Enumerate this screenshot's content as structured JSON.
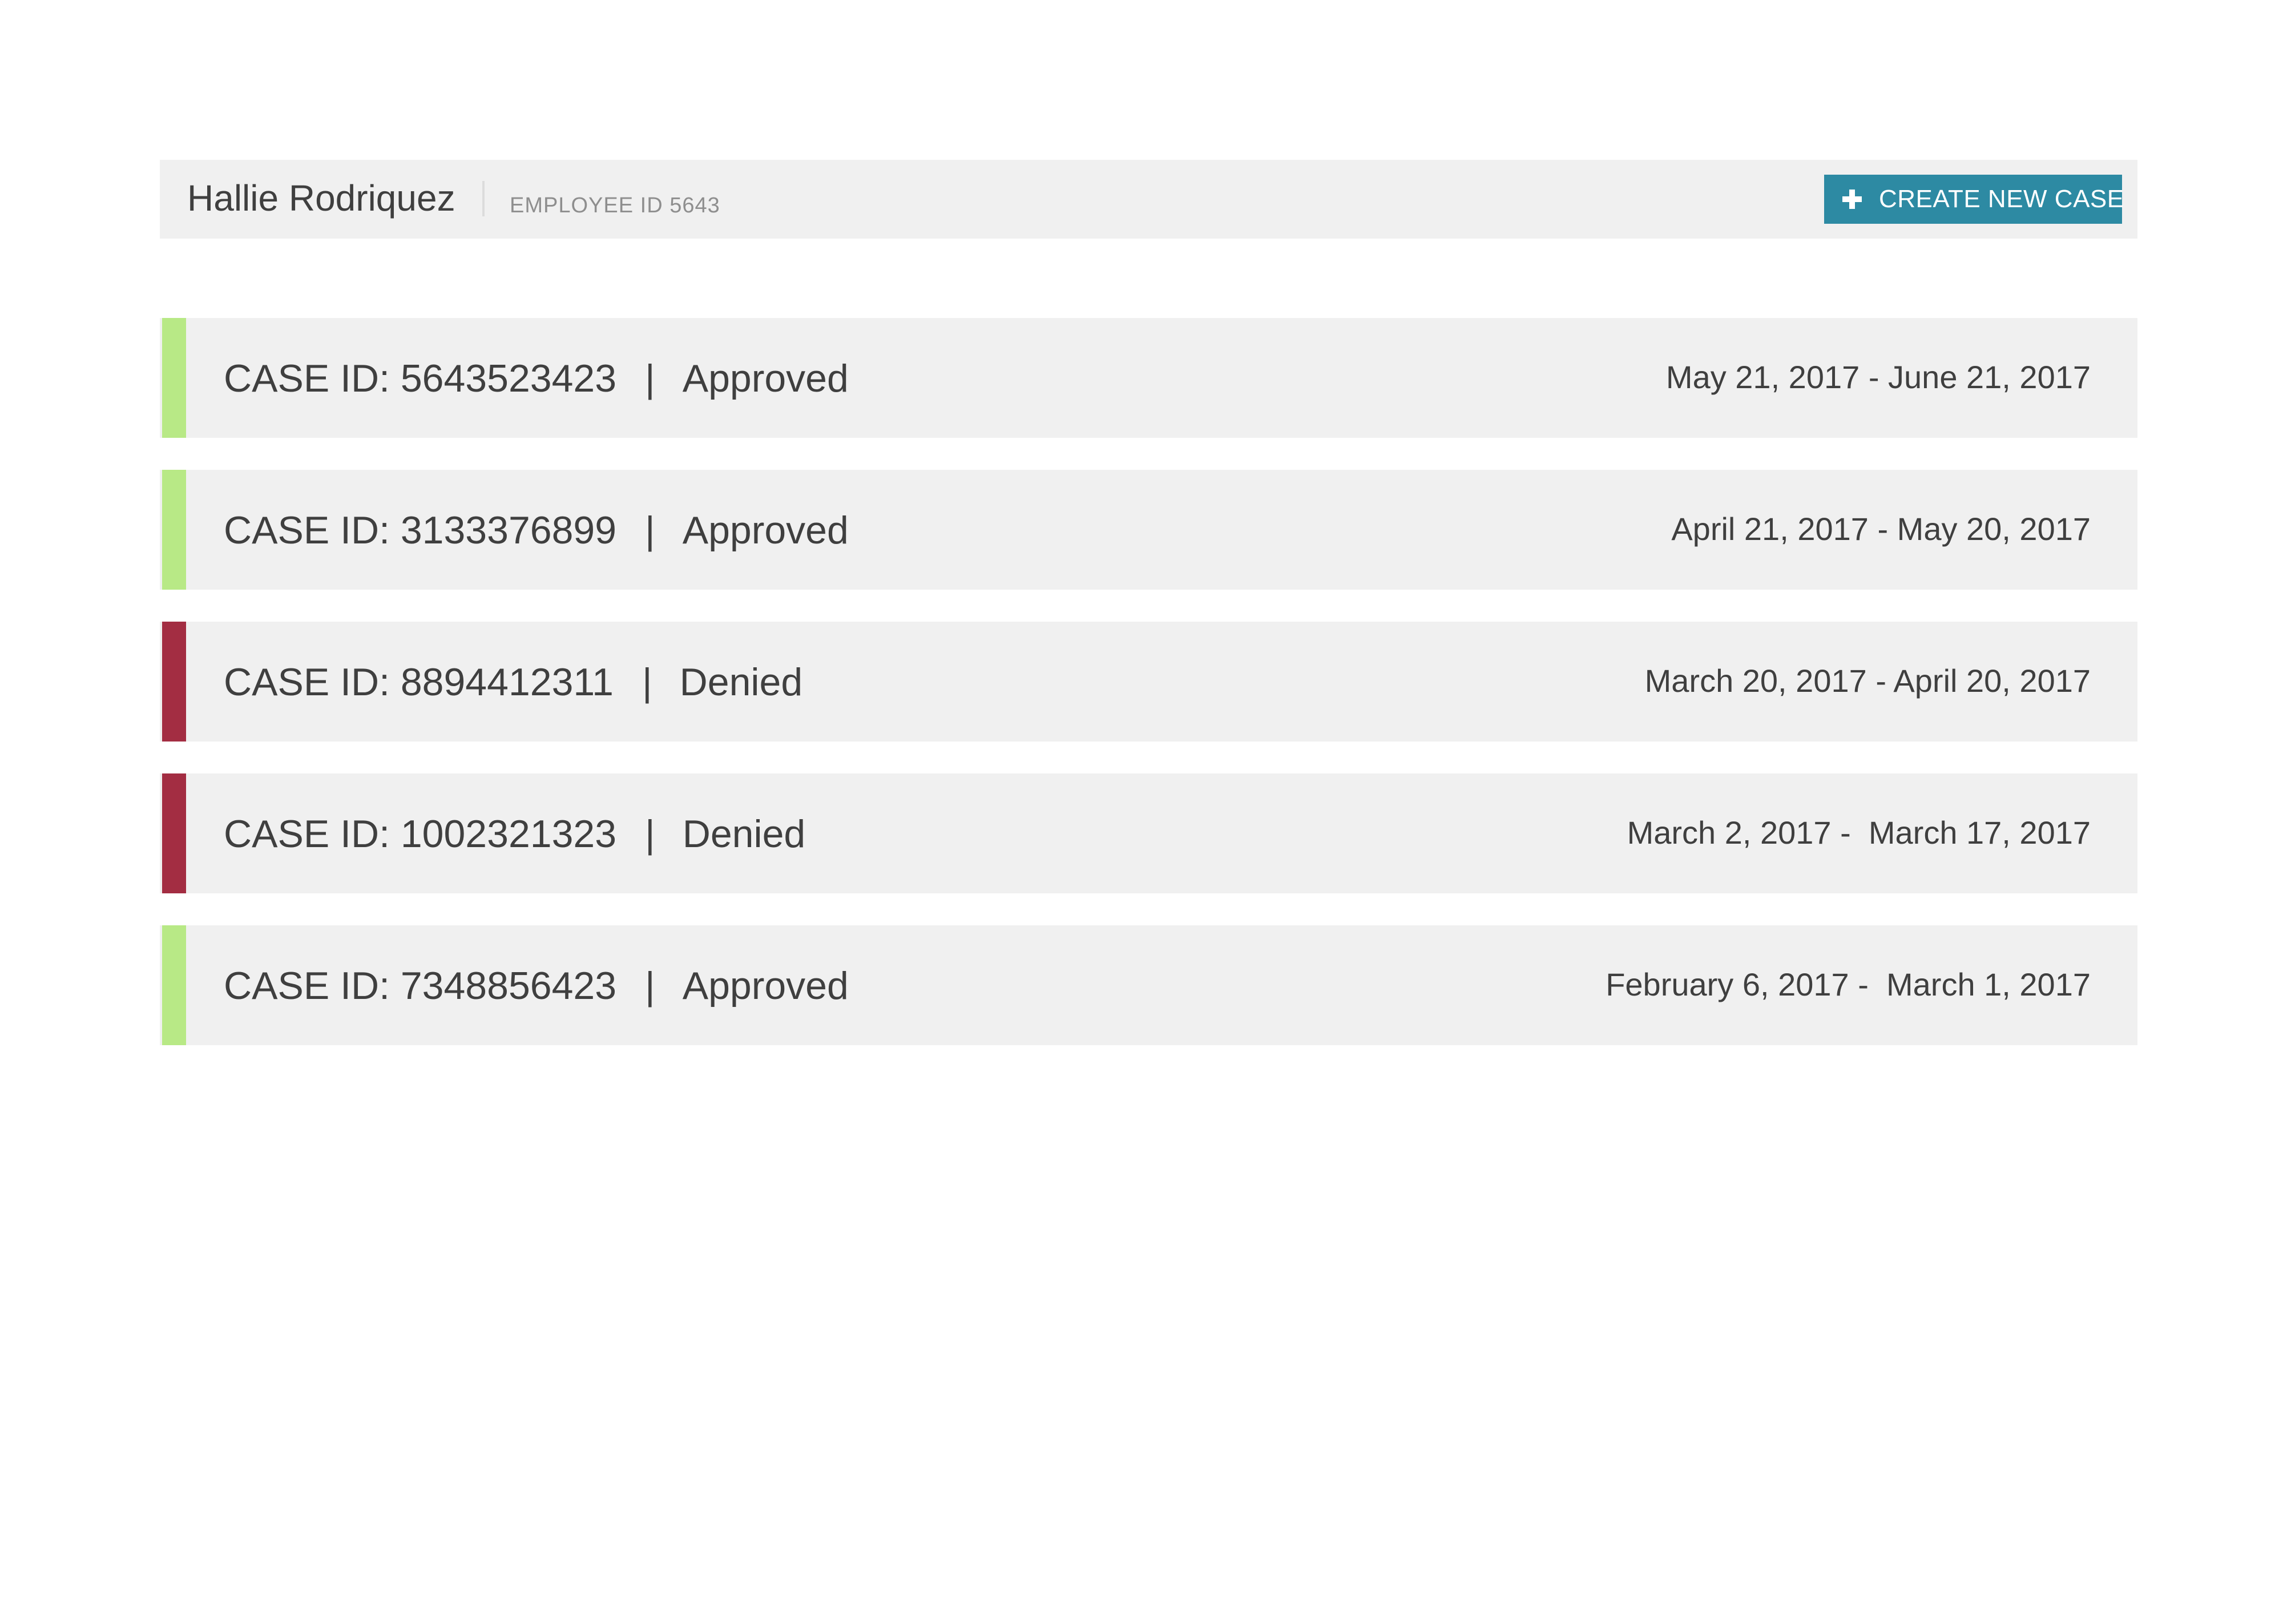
{
  "header": {
    "employee_name": "Hallie Rodriquez",
    "employee_id": "EMPLOYEE ID 5643",
    "create_button_label": "CREATE NEW CASE",
    "create_button_icon": "plus-icon"
  },
  "colors": {
    "approved": "#b8e986",
    "denied": "#a32d42",
    "accent": "#2d8aa3",
    "row_background": "#f0f0f0"
  },
  "cases": [
    {
      "case_id": "CASE ID: 5643523423",
      "separator": "|",
      "status": "Approved",
      "dates": "May 21, 2017 - June 21, 2017"
    },
    {
      "case_id": "CASE ID: 3133376899",
      "separator": "|",
      "status": "Approved",
      "dates": "April 21, 2017 - May 20, 2017"
    },
    {
      "case_id": "CASE ID: 8894412311",
      "separator": "|",
      "status": "Denied",
      "dates": "March 20, 2017 - April 20, 2017"
    },
    {
      "case_id": "CASE ID: 1002321323",
      "separator": "|",
      "status": "Denied",
      "dates": "March 2, 2017 -  March 17, 2017"
    },
    {
      "case_id": "CASE ID: 7348856423",
      "separator": "|",
      "status": "Approved",
      "dates": "February 6, 2017 -  March 1, 2017"
    }
  ]
}
